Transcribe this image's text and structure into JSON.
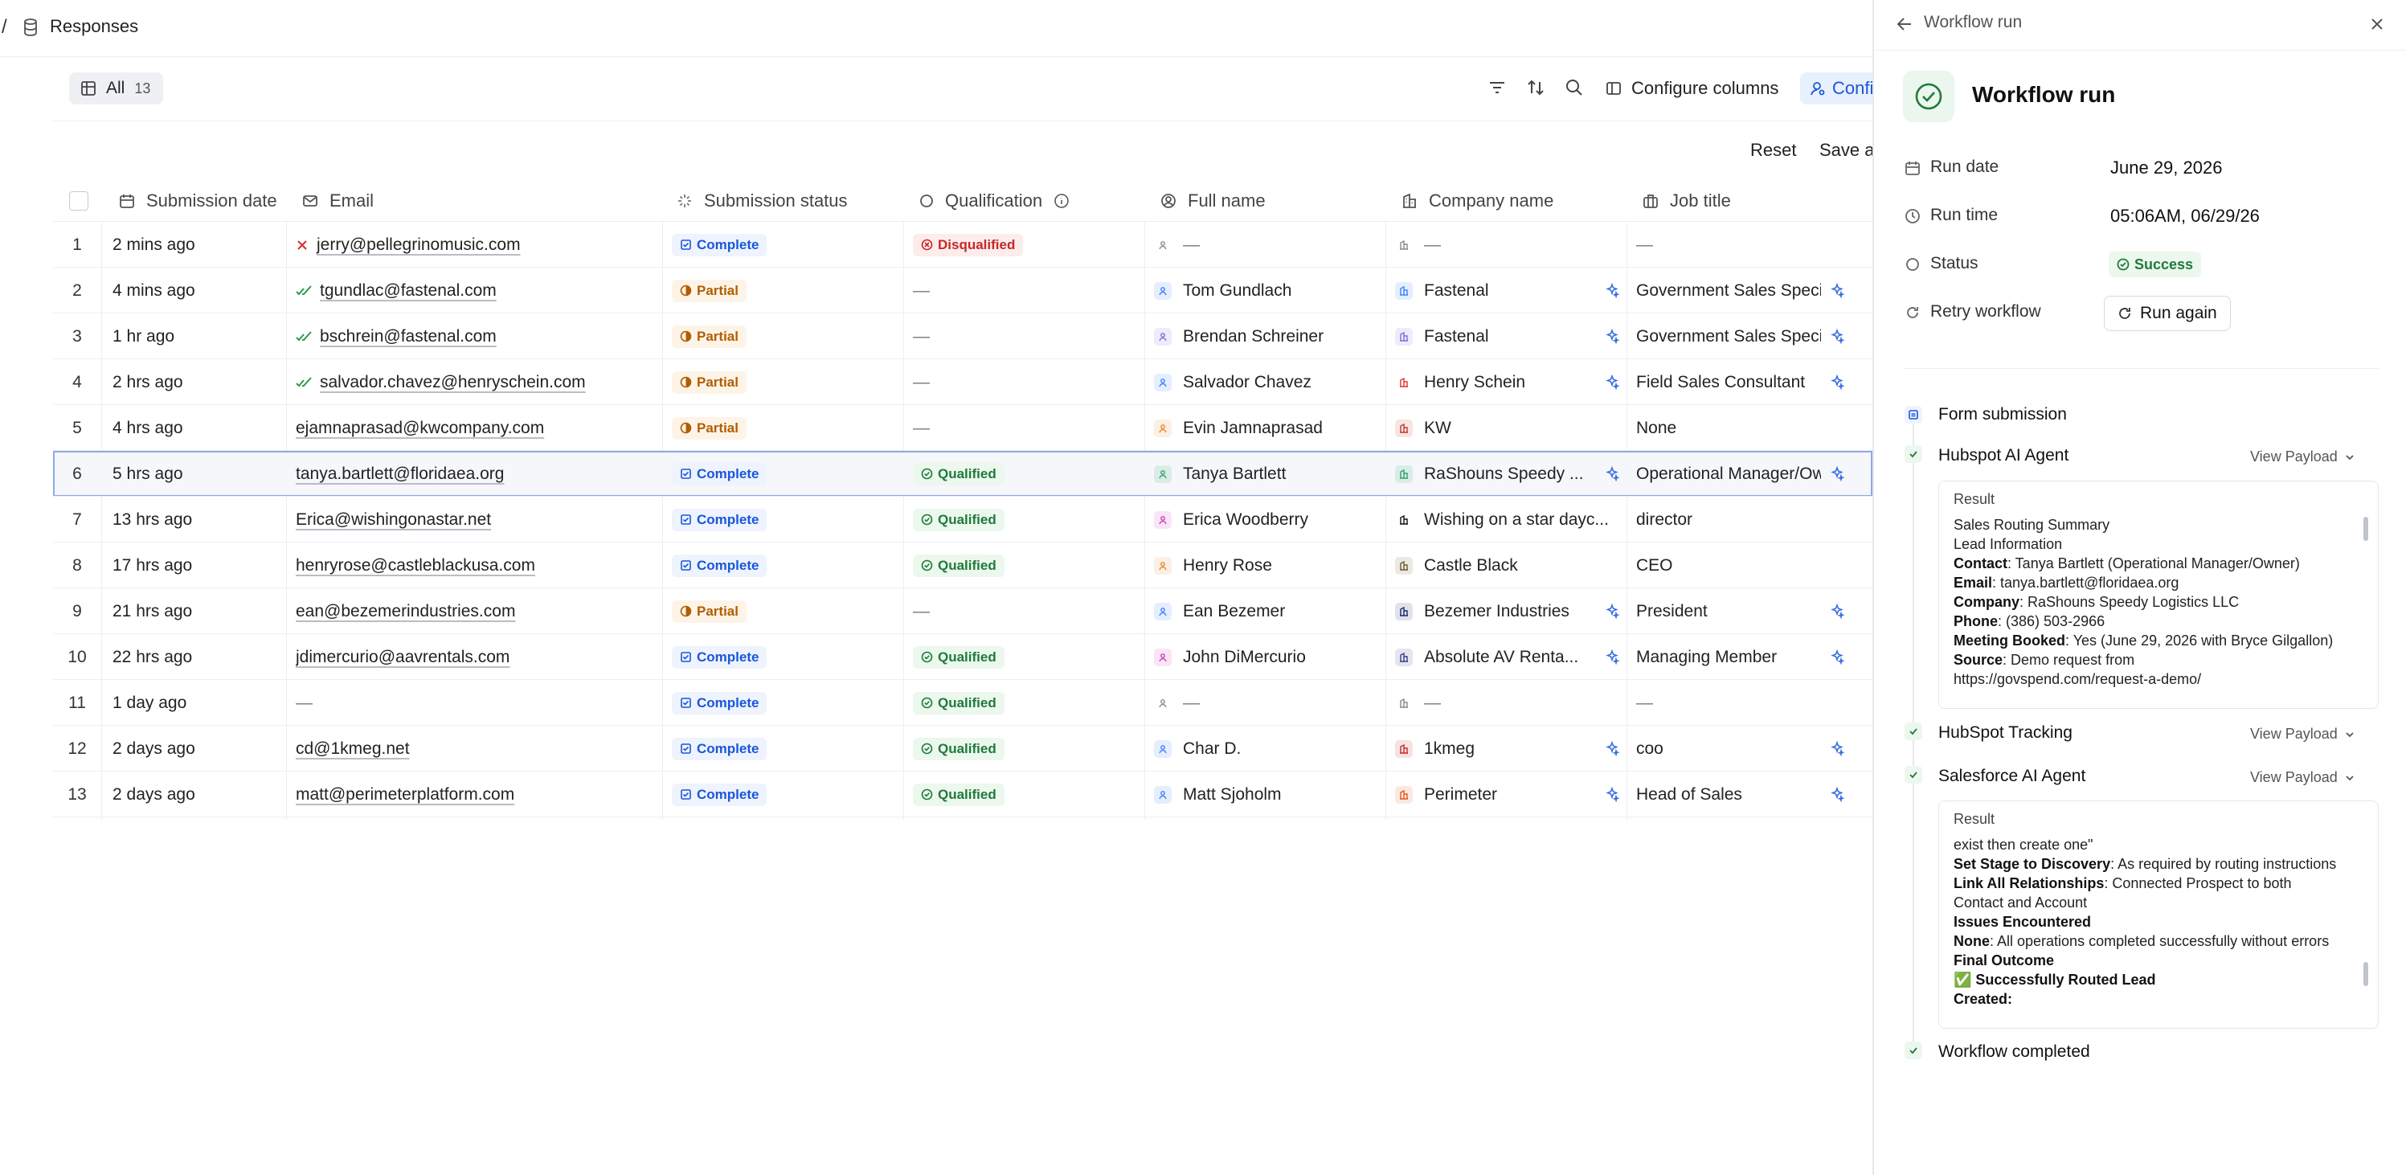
{
  "breadcrumb": {
    "separator": "/",
    "label": "Responses"
  },
  "toolbar": {
    "tab_label": "All",
    "tab_count": "13",
    "configure_columns": "Configure columns",
    "configure_truncated": "Confi",
    "reset": "Reset",
    "save_truncated": "Save a"
  },
  "table": {
    "columns": [
      "Submission date",
      "Email",
      "Submission status",
      "Qualification",
      "Full name",
      "Company name",
      "Job title"
    ],
    "rows": [
      {
        "n": "1",
        "date": "2 mins ago",
        "email": "jerry@pellegrinomusic.com",
        "email_check": "invalid",
        "status": "Complete",
        "qual": "Disqualified",
        "name": "—",
        "company": "—",
        "title": "—",
        "person_color": "#888",
        "company_color": "#888"
      },
      {
        "n": "2",
        "date": "4 mins ago",
        "email": "tgundlac@fastenal.com",
        "email_check": "verified",
        "status": "Partial",
        "qual": "—",
        "name": "Tom Gundlach",
        "company": "Fastenal",
        "title": "Government Sales Specia",
        "person_color": "#3b82f6",
        "company_color": "#3b82f6",
        "enrich": true
      },
      {
        "n": "3",
        "date": "1 hr ago",
        "email": "bschrein@fastenal.com",
        "email_check": "verified",
        "status": "Partial",
        "qual": "—",
        "name": "Brendan Schreiner",
        "company": "Fastenal",
        "title": "Government Sales Specia",
        "person_color": "#7c6fd6",
        "company_color": "#7c6fd6",
        "enrich": true
      },
      {
        "n": "4",
        "date": "2 hrs ago",
        "email": "salvador.chavez@henryschein.com",
        "email_check": "verified",
        "status": "Partial",
        "qual": "—",
        "name": "Salvador Chavez",
        "company": "Henry Schein",
        "title": "Field Sales Consultant",
        "person_color": "#3b82f6",
        "company_color": "#d33",
        "enrich": true
      },
      {
        "n": "5",
        "date": "4 hrs ago",
        "email": "ejamnaprasad@kwcompany.com",
        "email_check": "none",
        "status": "Partial",
        "qual": "—",
        "name": "Evin Jamnaprasad",
        "company": "KW",
        "title": "None",
        "person_color": "#e58a2c",
        "company_color": "#c0392b"
      },
      {
        "n": "6",
        "date": "5 hrs ago",
        "email": "tanya.bartlett@floridaea.org",
        "email_check": "none",
        "status": "Complete",
        "qual": "Qualified",
        "name": "Tanya Bartlett",
        "company": "RaShouns Speedy ...",
        "title": "Operational Manager/Ow",
        "person_color": "#2fa36b",
        "company_color": "#2fa36b",
        "enrich": true,
        "selected": true
      },
      {
        "n": "7",
        "date": "13 hrs ago",
        "email": "Erica@wishingonastar.net",
        "email_check": "none",
        "status": "Complete",
        "qual": "Qualified",
        "name": "Erica Woodberry",
        "company": "Wishing on a star dayc...",
        "title": "director",
        "person_color": "#d13bbd",
        "company_color": "#111"
      },
      {
        "n": "8",
        "date": "17 hrs ago",
        "email": "henryrose@castleblackusa.com",
        "email_check": "none",
        "status": "Complete",
        "qual": "Qualified",
        "name": "Henry Rose",
        "company": "Castle Black",
        "title": "CEO",
        "person_color": "#e58a2c",
        "company_color": "#6b5a2e"
      },
      {
        "n": "9",
        "date": "21 hrs ago",
        "email": "ean@bezemerindustries.com",
        "email_check": "none",
        "status": "Partial",
        "qual": "—",
        "name": "Ean Bezemer",
        "company": "Bezemer Industries",
        "title": "President",
        "person_color": "#3b82f6",
        "company_color": "#1b2a6b",
        "enrich": true
      },
      {
        "n": "10",
        "date": "22 hrs ago",
        "email": "jdimercurio@aavrentals.com",
        "email_check": "none",
        "status": "Complete",
        "qual": "Qualified",
        "name": "John DiMercurio",
        "company": "Absolute AV Renta...",
        "title": "Managing Member",
        "person_color": "#d13bbd",
        "company_color": "#3b3b8f",
        "enrich": true
      },
      {
        "n": "11",
        "date": "1 day ago",
        "email": "—",
        "email_check": "none",
        "status": "Complete",
        "qual": "Qualified",
        "name": "—",
        "company": "—",
        "title": "—",
        "person_color": "#888",
        "company_color": "#888"
      },
      {
        "n": "12",
        "date": "2 days ago",
        "email": "cd@1kmeg.net",
        "email_check": "none",
        "status": "Complete",
        "qual": "Qualified",
        "name": "Char D.",
        "company": "1kmeg",
        "title": "coo",
        "person_color": "#3b82f6",
        "company_color": "#c62828",
        "enrich": true
      },
      {
        "n": "13",
        "date": "2 days ago",
        "email": "matt@perimeterplatform.com",
        "email_check": "none",
        "status": "Complete",
        "qual": "Qualified",
        "name": "Matt Sjoholm",
        "company": "Perimeter",
        "title": "Head of Sales",
        "person_color": "#3b82f6",
        "company_color": "#e2571e",
        "enrich": true
      }
    ]
  },
  "panel": {
    "header_title": "Workflow run",
    "title": "Workflow run",
    "run_date_label": "Run date",
    "run_date": "June 29, 2026",
    "run_time_label": "Run time",
    "run_time": "05:06AM, 06/29/26",
    "status_label": "Status",
    "status": "Success",
    "retry_label": "Retry workflow",
    "run_again": "Run again",
    "steps": {
      "form_submission": "Form submission",
      "hubspot_ai": "Hubspot AI Agent",
      "hubspot_tracking": "HubSpot Tracking",
      "salesforce_ai": "Salesforce AI Agent",
      "completed": "Workflow completed",
      "view_payload": "View Payload"
    },
    "result1": {
      "title": "Result",
      "l1": "Sales Routing Summary",
      "l2": "Lead Information",
      "contact_k": "Contact",
      "contact_v": ": Tanya Bartlett (Operational Manager/Owner)",
      "email_k": "Email",
      "email_v": ": tanya.bartlett@floridaea.org",
      "company_k": "Company",
      "company_v": ": RaShouns Speedy Logistics LLC",
      "phone_k": "Phone",
      "phone_v": ": (386) 503-2966",
      "meeting_k": "Meeting Booked",
      "meeting_v": ": Yes (June 29, 2026 with Bryce Gilgallon)",
      "source_k": "Source",
      "source_v": ": Demo request from",
      "url": "https://govspend.com/request-a-demo/"
    },
    "result2": {
      "title": "Result",
      "l0": "exist then create one\"",
      "stage_k": "Set Stage to Discovery",
      "stage_v": ": As required by routing instructions",
      "link_k": "Link All Relationships",
      "link_v": ": Connected Prospect to both",
      "link_v2": "Contact and Account",
      "issues_k": "Issues Encountered",
      "none_k": "None",
      "none_v": ": All operations completed successfully without errors",
      "final_k": "Final Outcome",
      "routed_k": "✅ Successfully Routed Lead",
      "created_k": "Created:"
    }
  }
}
